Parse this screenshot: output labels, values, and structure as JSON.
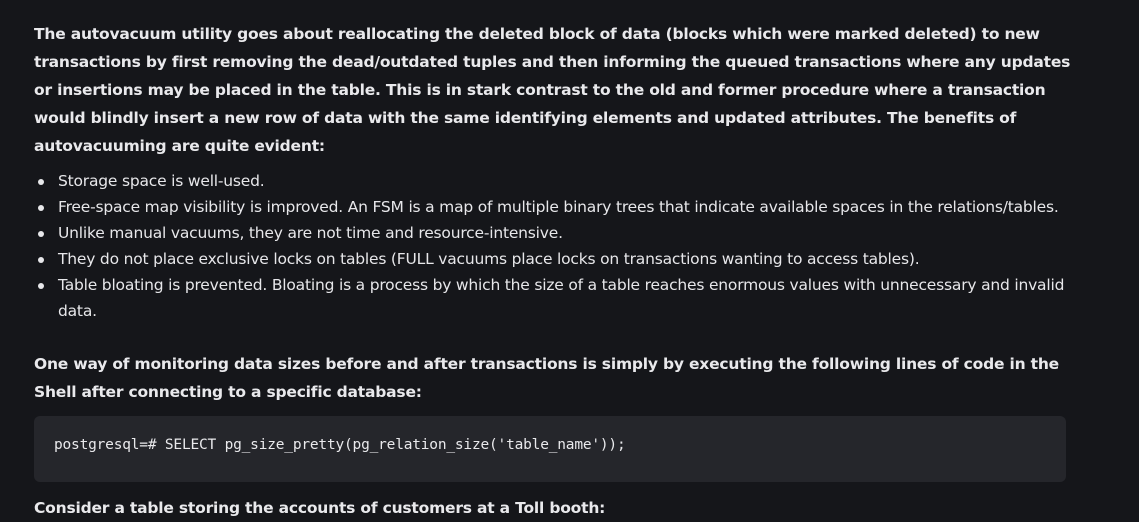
{
  "article": {
    "intro": "The autovacuum utility goes about reallocating the deleted block of data (blocks which were marked deleted) to new transactions by first removing the dead/outdated tuples and then informing the queued transactions where any updates or insertions may be placed in the table. This is in stark contrast to the old and former procedure where a transaction would blindly insert a new row of data with the same identifying elements and updated attributes. The benefits of autovacuuming are quite evident:",
    "benefits": [
      "Storage space is well-used.",
      "Free-space map visibility is improved. An FSM is a map of multiple binary trees that indicate available spaces in the relations/tables.",
      "Unlike manual vacuums, they are not time and resource-intensive.",
      "They do not place exclusive locks on tables (FULL vacuums place locks on transactions wanting to access tables).",
      "Table bloating is prevented. Bloating is a process by which the size of a table reaches enormous values with unnecessary and invalid data."
    ],
    "monitoring_paragraph": "One way of monitoring data sizes before and after transactions is simply by executing the following lines of code in the Shell after connecting to a specific database:",
    "code": "postgresql=# SELECT pg_size_pretty(pg_relation_size('table_name'));",
    "toll_paragraph": "Consider a table storing the accounts of customers at a Toll booth:"
  }
}
